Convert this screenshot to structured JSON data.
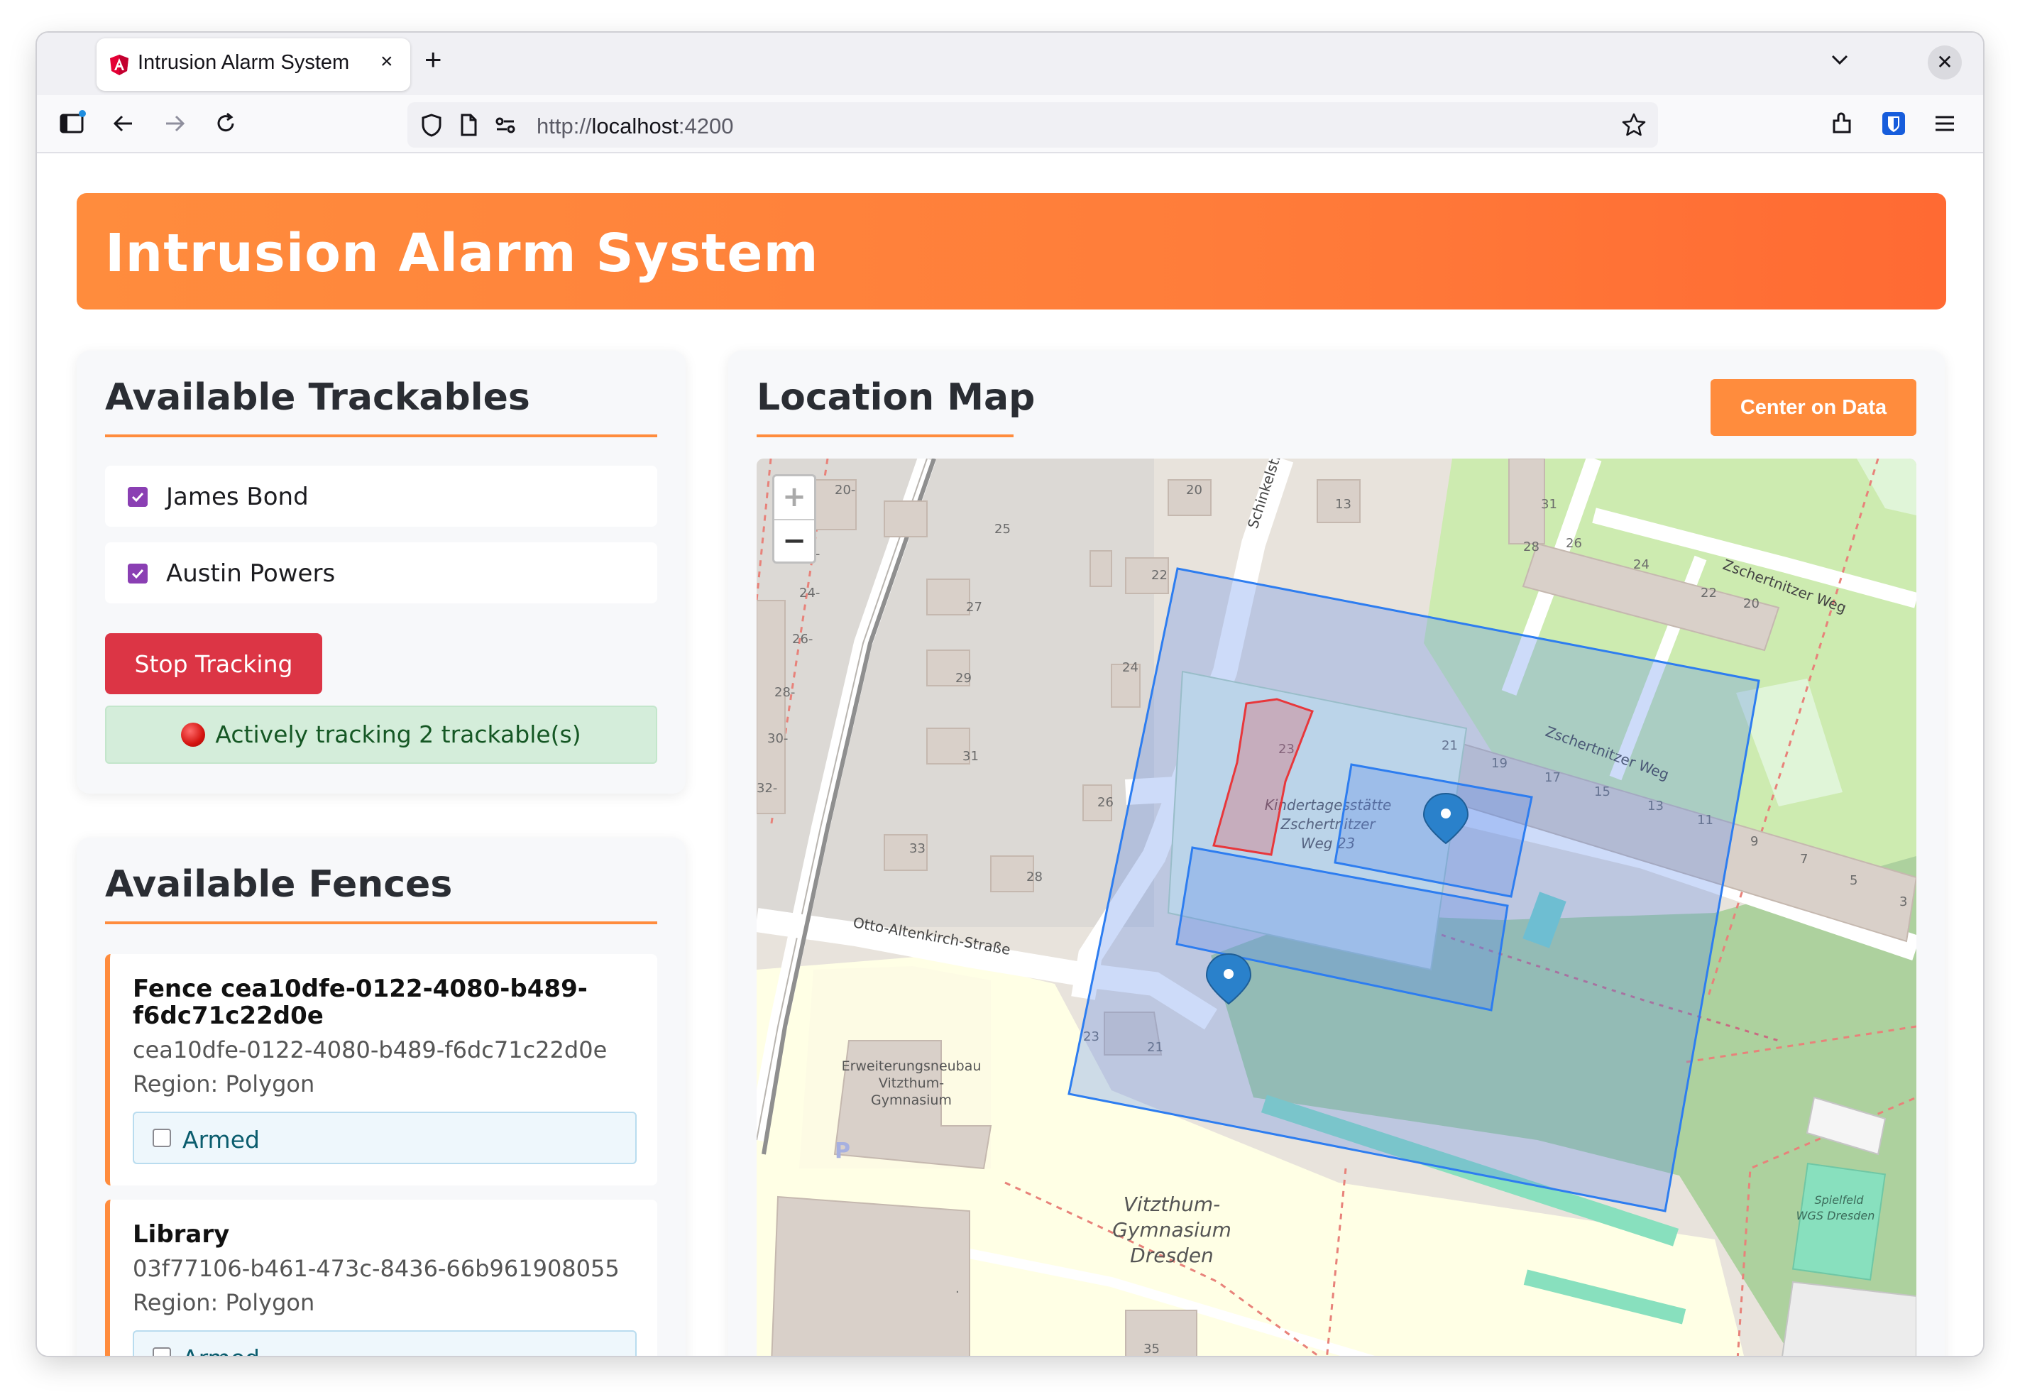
{
  "browser": {
    "tab_title": "Intrusion Alarm System",
    "tab_close": "×",
    "new_tab": "+",
    "url_scheme": "http://",
    "url_host": "localhost",
    "url_port": ":4200",
    "window_close": "✕"
  },
  "header": {
    "title": "Intrusion Alarm System"
  },
  "trackables": {
    "title": "Available Trackables",
    "items": [
      {
        "label": "James Bond",
        "checked": true
      },
      {
        "label": "Austin Powers",
        "checked": true
      }
    ],
    "stop_button": "Stop Tracking",
    "status": "Actively tracking 2 trackable(s)"
  },
  "fences": {
    "title": "Available Fences",
    "items": [
      {
        "name": "Fence cea10dfe-0122-4080-b489-f6dc71c22d0e",
        "id": "cea10dfe-0122-4080-b489-f6dc71c22d0e",
        "region": "Region: Polygon",
        "armed_label": "Armed",
        "armed": false
      },
      {
        "name": "Library",
        "id": "03f77106-b461-473c-8436-66b961908055",
        "region": "Region: Polygon",
        "armed_label": "Armed",
        "armed": false
      }
    ]
  },
  "map_panel": {
    "title": "Location Map",
    "center_button": "Center on Data",
    "zoom_in": "+",
    "zoom_out": "−",
    "labels": {
      "street_1": "Zschertnitzer Weg",
      "street_2": "Zschertnitzer Weg",
      "street_3": "Otto-Altenkirch-Straße",
      "street_4": "Schinkelstr.",
      "kita_1": "Kindertagesstätte",
      "kita_2": "Zschertnitzer",
      "kita_3": "Weg 23",
      "school_1": "Vitzthum-",
      "school_2": "Gymnasium",
      "school_3": "Dresden",
      "annex_1": "Erweiterungsneubau",
      "annex_2": "Vitzthum-",
      "annex_3": "Gymnasium",
      "field_1": "Spielfeld",
      "field_2": "WGS Dresden"
    },
    "colors": {
      "accent": "#ff8c3d",
      "fence_blue": "#2d7df0",
      "fence_red": "#e8373b",
      "park": "#cdebb0",
      "forest": "#add19e",
      "school": "#ffffe5"
    }
  }
}
